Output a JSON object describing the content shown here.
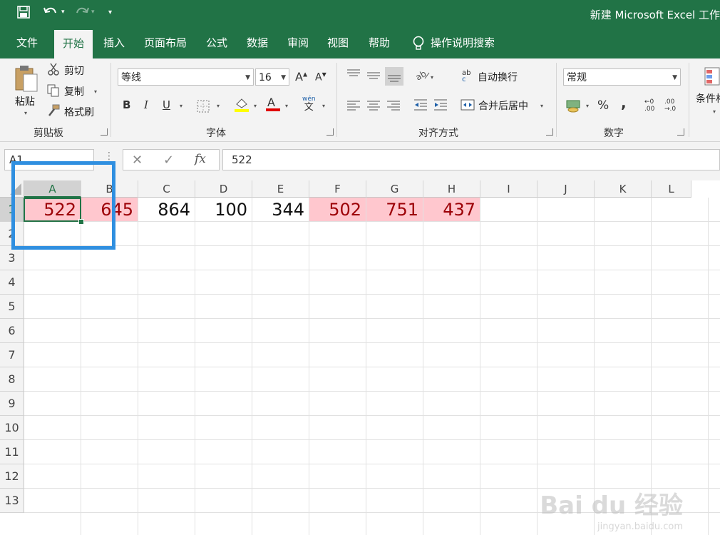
{
  "window": {
    "title": "新建 Microsoft Excel 工作"
  },
  "colors": {
    "brand": "#217346",
    "highlight": "#2f8fe0",
    "red_fill": "#ffc7ce",
    "red_text": "#9c0006"
  },
  "tabs": [
    "文件",
    "开始",
    "插入",
    "页面布局",
    "公式",
    "数据",
    "审阅",
    "视图",
    "帮助"
  ],
  "tell_me": "操作说明搜索",
  "ribbon": {
    "clipboard": {
      "paste": "粘贴",
      "cut": "剪切",
      "copy": "复制",
      "format_painter": "格式刷",
      "label": "剪贴板"
    },
    "font": {
      "name": "等线",
      "size": "16",
      "label": "字体",
      "bold": "B",
      "italic": "I",
      "underline": "U",
      "phonetic_top": "wén",
      "phonetic_bottom": "文"
    },
    "alignment": {
      "wrap": "自动换行",
      "merge": "合并后居中",
      "label": "对齐方式",
      "wrap_icon_top": "ab",
      "wrap_icon_bottom": "c"
    },
    "number": {
      "format": "常规",
      "label": "数字",
      "percent": "%",
      "comma": ",",
      "inc_top": "←0",
      "inc_bottom": ".00",
      "dec_top": ".00",
      "dec_bottom": "→.0"
    },
    "styles": {
      "conditional": "条件格"
    }
  },
  "formula_bar": {
    "namebox": "A1",
    "fx": "fx",
    "value": "522"
  },
  "sheet": {
    "columns": [
      "A",
      "B",
      "C",
      "D",
      "E",
      "F",
      "G",
      "H",
      "I",
      "J",
      "K",
      "L"
    ],
    "rows": [
      "1",
      "2",
      "3",
      "4",
      "5",
      "6",
      "7",
      "8",
      "9",
      "10",
      "11",
      "12",
      "13"
    ],
    "row1": [
      {
        "value": "522",
        "highlight": true
      },
      {
        "value": "645",
        "highlight": true
      },
      {
        "value": "864",
        "highlight": false
      },
      {
        "value": "100",
        "highlight": false
      },
      {
        "value": "344",
        "highlight": false
      },
      {
        "value": "502",
        "highlight": true
      },
      {
        "value": "751",
        "highlight": true
      },
      {
        "value": "437",
        "highlight": true
      }
    ]
  },
  "watermark": {
    "main": "Bai du 经验",
    "sub": "jingyan.baidu.com"
  }
}
